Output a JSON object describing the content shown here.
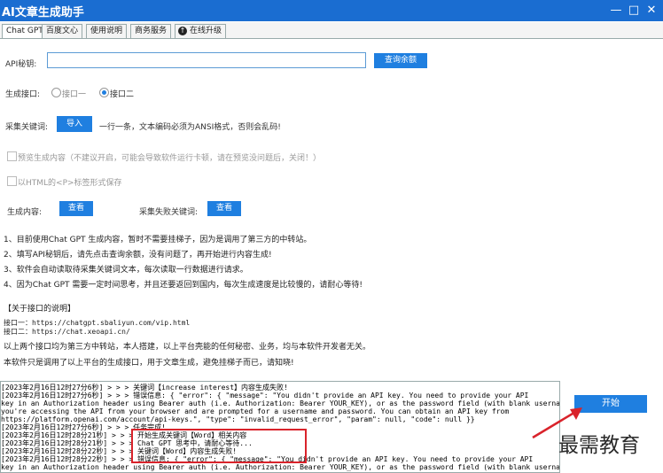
{
  "window": {
    "title": "AI文章生成助手",
    "minimize": "—",
    "maximize": "□",
    "close": "✕"
  },
  "tabs": [
    "Chat GPT",
    "百度文心",
    "使用说明",
    "商务服务",
    "在线升级"
  ],
  "api_key": {
    "label": "API秘钥:",
    "value": "",
    "placeholder": "",
    "button": "查询余额"
  },
  "gen_interface": {
    "label": "生成接口:",
    "option1": "接口一",
    "option2": "接口二",
    "selected": "接口二"
  },
  "keywords": {
    "label": "采集关键词:",
    "button": "导入",
    "hint": "一行一条，文本编码必须为ANSI格式，否则会乱码!"
  },
  "options": {
    "preview": "预览生成内容（不建议开启，可能会导致软件运行卡顿，请在预览没问题后，关闭！）",
    "html_p": "以HTML的<P>标签形式保存"
  },
  "views": {
    "content_label": "生成内容:",
    "content_button": "查看",
    "failed_label": "采集失败关键词:",
    "failed_button": "查看"
  },
  "notes": [
    "1、目前使用Chat GPT 生成内容，暂时不需要挂梯子，因为是调用了第三方的中转站。",
    "2、填写API秘钥后，请先点击查询余额，没有问题了，再开始进行内容生成!",
    "3、软件会自动读取待采集关键词文本，每次读取一行数据进行请求。",
    "4、因为Chat GPT 需要一定时间思考，并且还要返回到国内，每次生成速度是比较慢的，请耐心等待!"
  ],
  "about": {
    "title": "【关于接口的说明】",
    "url1": "接口一：https://chatgpt.sbaliyun.com/vip.html",
    "url2": "接口二：https://chat.xeoapi.cn/",
    "desc1": "以上两个接口均为第三方中转站，本人搭建，以上平台壳能的任何秘密、业务，均与本软件开发者无关。",
    "desc2": "本软件只是调用了以上平台的生成接口，用于文章生成，避免挂梯子而已，请知晓!"
  },
  "log": [
    "[2023年2月16日12时27分6秒] > > >  关键词【increase interest】内容生成失败!",
    "[2023年2月16日12时27分6秒] > > >  错误信息: {    \"error\": {        \"message\": \"You didn't provide an API key. You need to provide your API",
    "key in an Authorization header using Bearer auth (i.e. Authorization: Bearer YOUR_KEY), or as the password field (with blank username) if",
    "you're accessing the API from your browser and are prompted for a username and password. You can obtain an API key from",
    "https://platform.openai.com/account/api-keys.\",        \"type\": \"invalid_request_error\",        \"param\": null,        \"code\": null    }}",
    "[2023年2月16日12时27分6秒] > > >  任务完成!",
    "[2023年2月16日12时28分21秒] > > >  开始生成关键词【Word】相关内容",
    "[2023年2月16日12时28分21秒] > > >  Chat GPT 思考中，请耐心等待...",
    "[2023年2月16日12时28分22秒] > > >  关键词【Word】内容生成失败!",
    "[2023年2月16日12时28分22秒] > > >  错误信息: {    \"error\": {        \"message\": \"You didn't provide an API key. You need to provide your API",
    "key in an Authorization header using Bearer auth (i.e. Authorization: Bearer YOUR_KEY), or as the password field (with blank username) if"
  ],
  "start_button": "开始",
  "watermark": "最需教育",
  "colors": {
    "titlebar": "#1a6dd1",
    "button": "#1f7fe0",
    "highlight_box": "#d9232b"
  }
}
